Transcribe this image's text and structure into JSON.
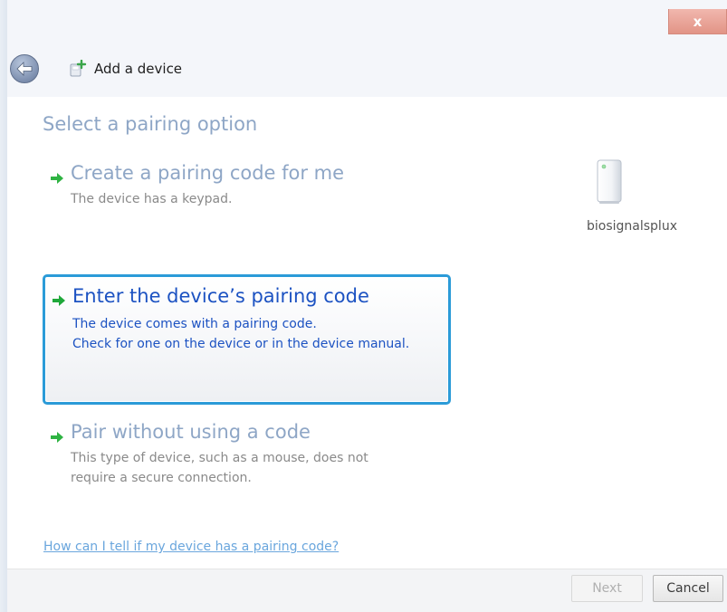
{
  "window": {
    "title": "Add a device",
    "close_symbol": "x"
  },
  "content": {
    "heading": "Select a pairing option",
    "options": [
      {
        "title": "Create a pairing code for me",
        "description_lines": [
          "The device has a keypad."
        ],
        "icon": "green-arrow-icon",
        "selected": false
      },
      {
        "title": "Enter the device’s pairing code",
        "description_lines": [
          "The device comes with a pairing code.",
          "Check for one on the device or in the device manual."
        ],
        "icon": "green-arrow-icon",
        "selected": true
      },
      {
        "title": "Pair without using a code",
        "description_lines": [
          "This type of device, such as a mouse, does not",
          "require a secure connection."
        ],
        "icon": "green-arrow-icon",
        "selected": false
      }
    ],
    "device": {
      "name": "biosignalsplux",
      "icon": "device-tower-icon"
    },
    "help_link": "How can I tell if my device has a pairing code?"
  },
  "footer": {
    "next_label": "Next",
    "next_enabled": false,
    "cancel_label": "Cancel"
  },
  "colors": {
    "accent_blue": "#2b9bd8",
    "selected_text": "#1c52c2",
    "muted_heading": "#8ea6c6",
    "arrow_green": "#2fb343",
    "close_red": "#e29486"
  }
}
